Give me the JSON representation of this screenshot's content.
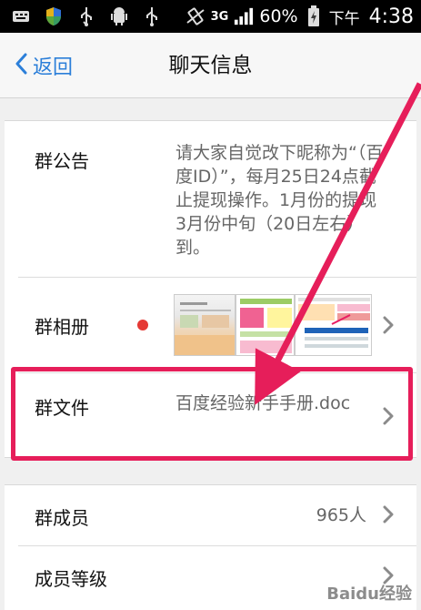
{
  "status_bar": {
    "network": "3G",
    "battery": "60%",
    "ampm": "下午",
    "time": "4:38"
  },
  "nav": {
    "back_label": "返回",
    "title": "聊天信息"
  },
  "rows": {
    "notice": {
      "label": "群公告",
      "value": "请大家自觉改下昵称为“（百度ID）”，每月25日24点截止提现操作。1月份的提现3月份中旬（20日左右）到。"
    },
    "album": {
      "label": "群相册",
      "has_new": true
    },
    "files": {
      "label": "群文件",
      "value": "百度经验新手手册.doc"
    },
    "members": {
      "label": "群成员",
      "value": "965人"
    },
    "level": {
      "label": "成员等级"
    }
  },
  "annotation": {
    "color": "#e61e5a"
  },
  "watermark": "Baidu经验"
}
